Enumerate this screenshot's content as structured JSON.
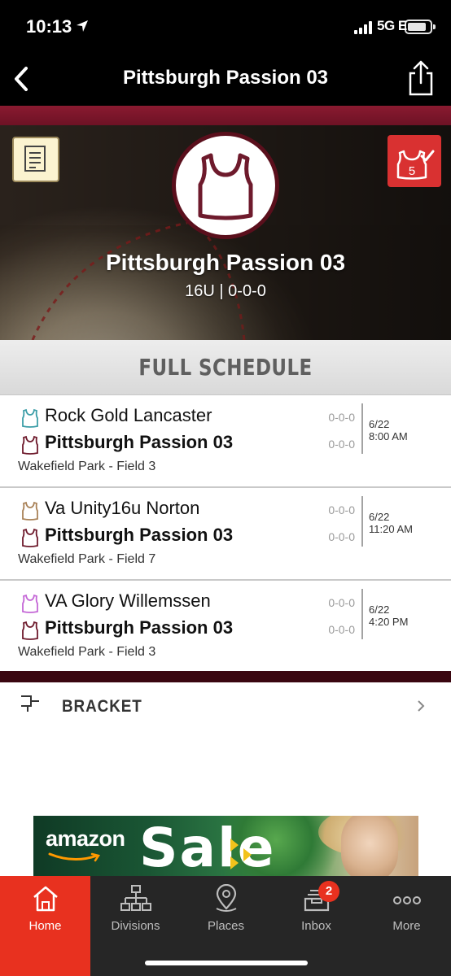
{
  "status_bar": {
    "time": "10:13",
    "network": "5G E"
  },
  "nav": {
    "title": "Pittsburgh Passion 03",
    "back_icon": "chevron-left-icon",
    "share_icon": "share-icon"
  },
  "hero": {
    "team_name": "Pittsburgh Passion 03",
    "record": "16U | 0-0-0",
    "notes_icon": "notes-icon",
    "checkin_icon": "checkin-icon",
    "checkin_count": "5"
  },
  "schedule": {
    "title": "FULL SCHEDULE",
    "games": [
      {
        "away_team": "Rock Gold Lancaster",
        "away_record": "0-0-0",
        "away_color": "#3d9ea8",
        "home_team": "Pittsburgh Passion 03",
        "home_record": "0-0-0",
        "home_color": "#6e1a2c",
        "date": "6/22",
        "time": "8:00 AM",
        "venue": "Wakefield Park - Field 3"
      },
      {
        "away_team": "Va Unity16u Norton",
        "away_record": "0-0-0",
        "away_color": "#a98258",
        "home_team": "Pittsburgh Passion 03",
        "home_record": "0-0-0",
        "home_color": "#6e1a2c",
        "date": "6/22",
        "time": "11:20 AM",
        "venue": "Wakefield Park - Field 7"
      },
      {
        "away_team": "VA Glory Willemssen",
        "away_record": "0-0-0",
        "away_color": "#c467d6",
        "home_team": "Pittsburgh Passion 03",
        "home_record": "0-0-0",
        "home_color": "#6e1a2c",
        "date": "6/22",
        "time": "4:20 PM",
        "venue": "Wakefield Park - Field 3"
      }
    ]
  },
  "bracket": {
    "label": "BRACKET"
  },
  "ad": {
    "brand": "amazon",
    "headline": "Sale"
  },
  "tabs": [
    {
      "label": "Home",
      "icon": "home-icon",
      "active": true
    },
    {
      "label": "Divisions",
      "icon": "divisions-icon",
      "active": false
    },
    {
      "label": "Places",
      "icon": "map-pin-icon",
      "active": false
    },
    {
      "label": "Inbox",
      "icon": "inbox-icon",
      "active": false,
      "badge": "2"
    },
    {
      "label": "More",
      "icon": "more-icon",
      "active": false
    }
  ],
  "colors": {
    "accent": "#e8311f",
    "team_maroon": "#6e1a2c"
  }
}
